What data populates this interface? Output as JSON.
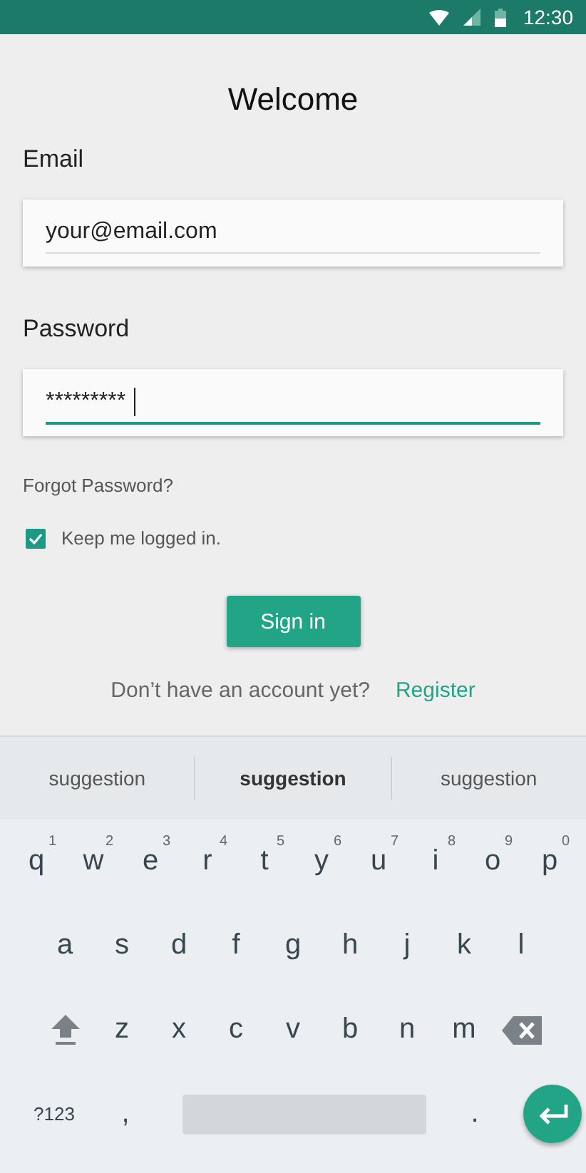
{
  "status_bar": {
    "time": "12:30"
  },
  "title": "Welcome",
  "fields": [
    {
      "label": "Email",
      "value": "your@email.com",
      "focused": false
    },
    {
      "label": "Password",
      "value": "*********",
      "focused": true
    }
  ],
  "forgot_link": "Forgot Password?",
  "keep_logged_in": {
    "label": "Keep me logged in.",
    "checked": true
  },
  "sign_in_button": "Sign in",
  "register_prompt": {
    "text": "Don’t have an account yet?",
    "link": "Register"
  },
  "keyboard": {
    "suggestions": [
      {
        "text": "suggestion",
        "selected": false
      },
      {
        "text": "suggestion",
        "selected": true
      },
      {
        "text": "suggestion",
        "selected": false
      }
    ],
    "rows": [
      [
        {
          "kind": "letter",
          "label": "q",
          "hint": "1"
        },
        {
          "kind": "letter",
          "label": "w",
          "hint": "2"
        },
        {
          "kind": "letter",
          "label": "e",
          "hint": "3"
        },
        {
          "kind": "letter",
          "label": "r",
          "hint": "4"
        },
        {
          "kind": "letter",
          "label": "t",
          "hint": "5"
        },
        {
          "kind": "letter",
          "label": "y",
          "hint": "6"
        },
        {
          "kind": "letter",
          "label": "u",
          "hint": "7"
        },
        {
          "kind": "letter",
          "label": "i",
          "hint": "8"
        },
        {
          "kind": "letter",
          "label": "o",
          "hint": "9"
        },
        {
          "kind": "letter",
          "label": "p",
          "hint": "0"
        }
      ],
      [
        {
          "kind": "letter",
          "label": "a"
        },
        {
          "kind": "letter",
          "label": "s"
        },
        {
          "kind": "letter",
          "label": "d"
        },
        {
          "kind": "letter",
          "label": "f"
        },
        {
          "kind": "letter",
          "label": "g"
        },
        {
          "kind": "letter",
          "label": "h"
        },
        {
          "kind": "letter",
          "label": "j"
        },
        {
          "kind": "letter",
          "label": "k"
        },
        {
          "kind": "letter",
          "label": "l"
        }
      ],
      [
        {
          "kind": "shift"
        },
        {
          "kind": "letter",
          "label": "z"
        },
        {
          "kind": "letter",
          "label": "x"
        },
        {
          "kind": "letter",
          "label": "c"
        },
        {
          "kind": "letter",
          "label": "v"
        },
        {
          "kind": "letter",
          "label": "b"
        },
        {
          "kind": "letter",
          "label": "n"
        },
        {
          "kind": "letter",
          "label": "m"
        },
        {
          "kind": "backspace"
        }
      ],
      [
        {
          "kind": "symbols",
          "label": "?123"
        },
        {
          "kind": "letter",
          "label": ","
        },
        {
          "kind": "space"
        },
        {
          "kind": "letter",
          "label": "."
        },
        {
          "kind": "enter"
        }
      ]
    ]
  }
}
